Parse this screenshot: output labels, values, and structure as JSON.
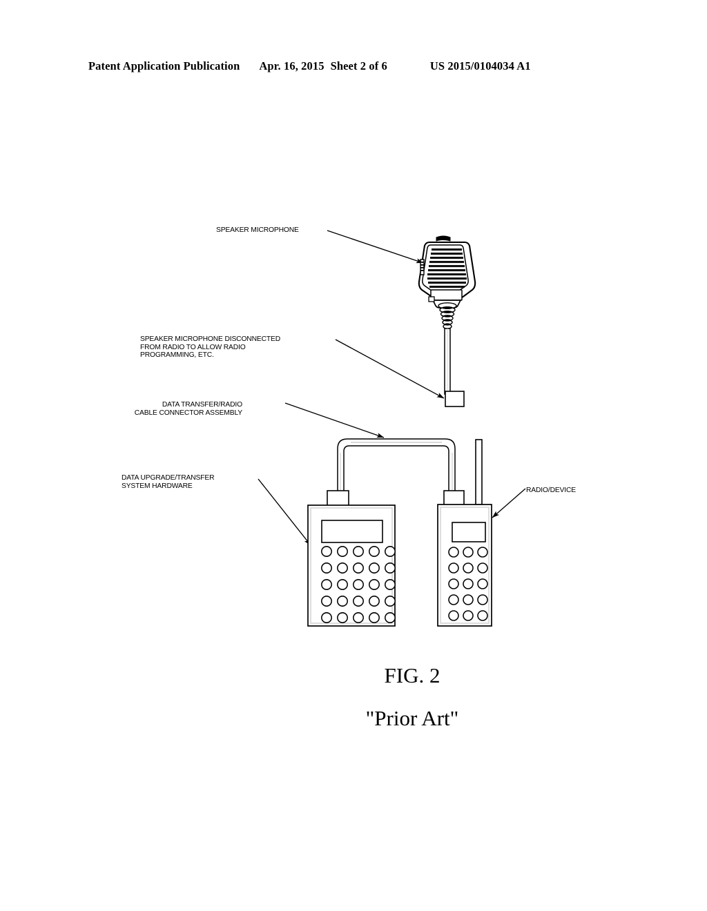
{
  "header": {
    "publication": "Patent Application Publication",
    "date": "Apr. 16, 2015",
    "sheet": "Sheet 2 of 6",
    "number": "US 2015/0104034 A1"
  },
  "figure": {
    "caption_line1": "FIG. 2",
    "caption_line2": "\"Prior Art\"",
    "callouts": [
      {
        "id": "speaker-microphone",
        "text": "SPEAKER MICROPHONE"
      },
      {
        "id": "speaker-microphone-disconnected",
        "text": "SPEAKER MICROPHONE DISCONNECTED\nFROM RADIO TO ALLOW RADIO\nPROGRAMMING, ETC."
      },
      {
        "id": "data-transfer-cable-connector",
        "text": "DATA TRANSFER/RADIO\nCABLE CONNECTOR ASSEMBLY"
      },
      {
        "id": "data-upgrade-system-hardware",
        "text": "DATA UPGRADE/TRANSFER\nSYSTEM HARDWARE"
      },
      {
        "id": "radio-device",
        "text": "RADIO/DEVICE"
      }
    ],
    "components": {
      "speaker_microphone": "speaker-microphone-drawing",
      "coiled_strain_relief": "coiled-cable-drawing",
      "mic_cable": "microphone-cable-drawing",
      "cable_connector_plug": "cable-connector-plug-drawing",
      "programmer_unit": "data-upgrade-transfer-hardware-drawing",
      "radio_unit": "radio-device-drawing",
      "interconnect_cable": "interconnect-cable-drawing",
      "antenna": "radio-antenna-drawing"
    },
    "programmer_keypad": {
      "rows": 5,
      "cols": 5
    },
    "radio_keypad": {
      "rows": 5,
      "cols": 3
    },
    "colors": {
      "ink": "#000000",
      "paper": "#ffffff",
      "fill_light": "#f2f2f2"
    }
  }
}
